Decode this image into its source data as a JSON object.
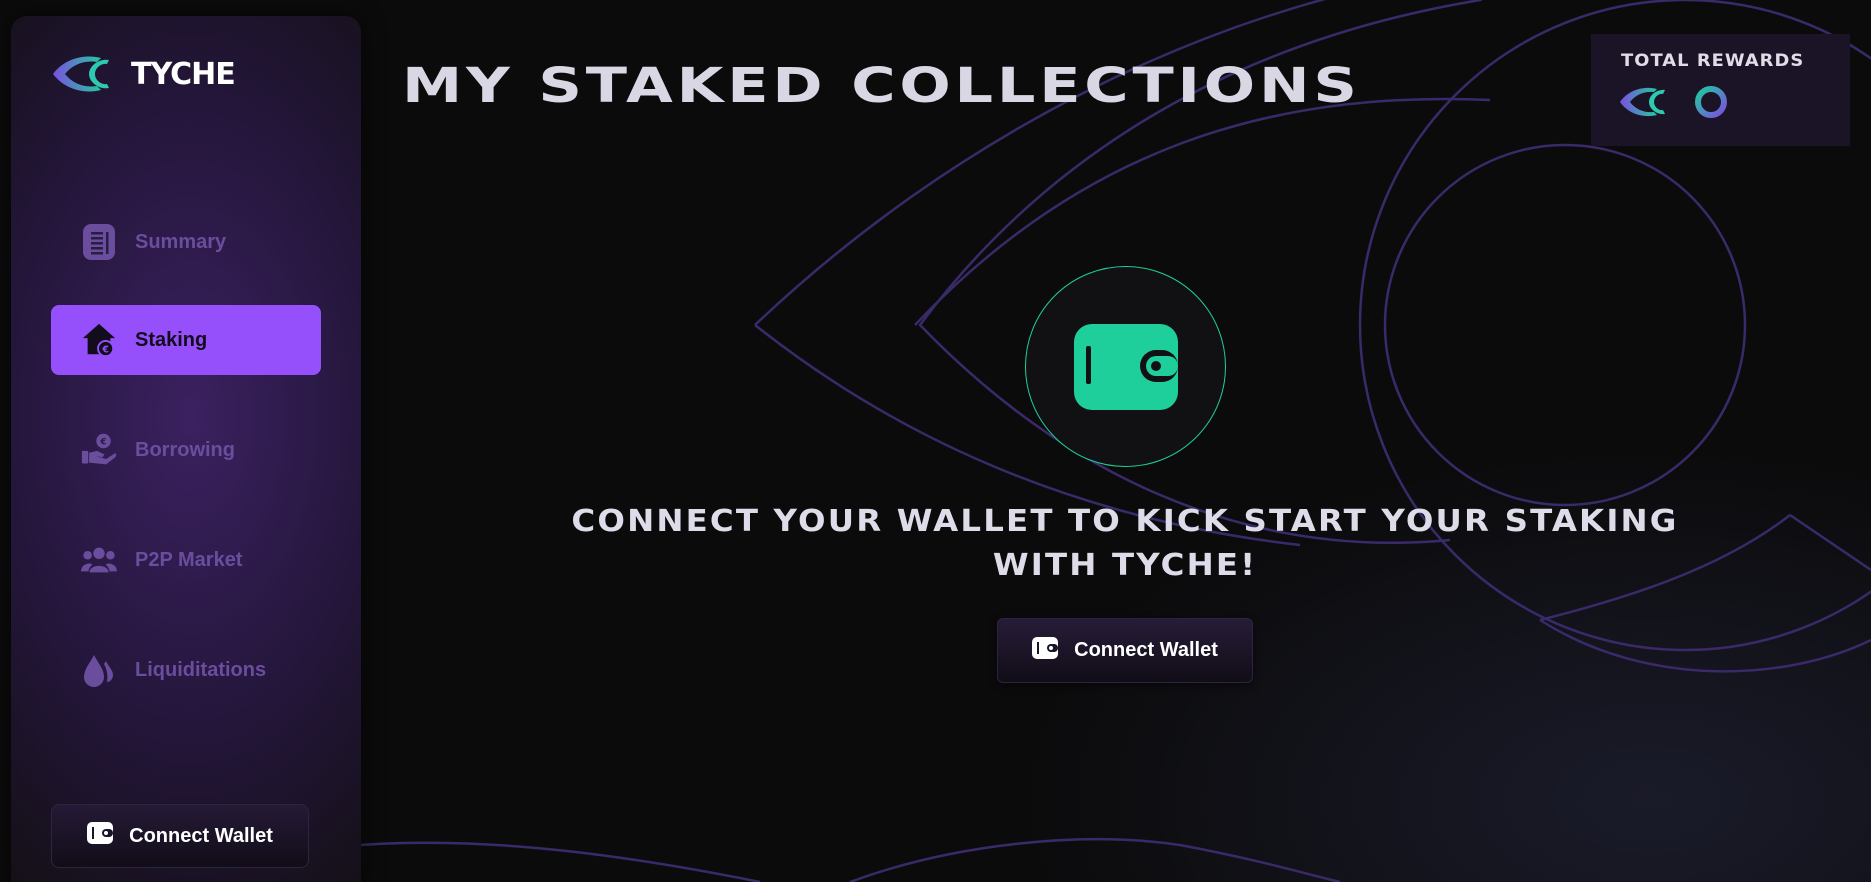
{
  "brand": {
    "name": "TYCHE"
  },
  "sidebar": {
    "items": [
      {
        "label": "Summary",
        "icon": "summary-icon",
        "active": false
      },
      {
        "label": "Staking",
        "icon": "staking-icon",
        "active": true
      },
      {
        "label": "Borrowing",
        "icon": "borrowing-icon",
        "active": false
      },
      {
        "label": "P2P Market",
        "icon": "p2p-market-icon",
        "active": false
      },
      {
        "label": "Liquiditations",
        "icon": "liquidations-icon",
        "active": false
      }
    ],
    "connect_label": "Connect Wallet"
  },
  "header": {
    "title": "MY STAKED COLLECTIONS",
    "rewards_title": "TOTAL REWARDS"
  },
  "main": {
    "cta_line1": "CONNECT YOUR WALLET TO KICK START YOUR STAKING",
    "cta_line2": "WITH TYCHE!",
    "connect_label": "Connect Wallet"
  },
  "colors": {
    "accent": "#9650fb",
    "teal": "#1fcf9b",
    "background": "#0b0b0c",
    "nav_inactive": "#6b4d9e"
  }
}
